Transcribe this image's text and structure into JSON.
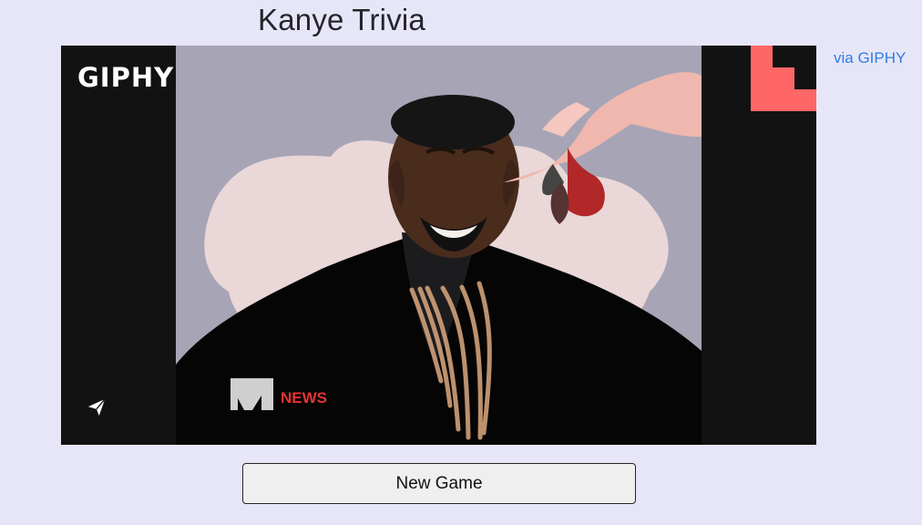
{
  "page": {
    "title": "Kanye Trivia"
  },
  "gif": {
    "logo_text": "GIPHY",
    "alt": "Kanye West smiling in an MTV News interview",
    "share_icon": "paper-plane-icon"
  },
  "link": {
    "via_giphy_label": "via GIPHY"
  },
  "controls": {
    "new_game_label": "New Game"
  },
  "colors": {
    "background": "#e7e6f8",
    "frame_bg": "#121212",
    "link": "#2d7de3",
    "sticker": "#ff6666"
  }
}
